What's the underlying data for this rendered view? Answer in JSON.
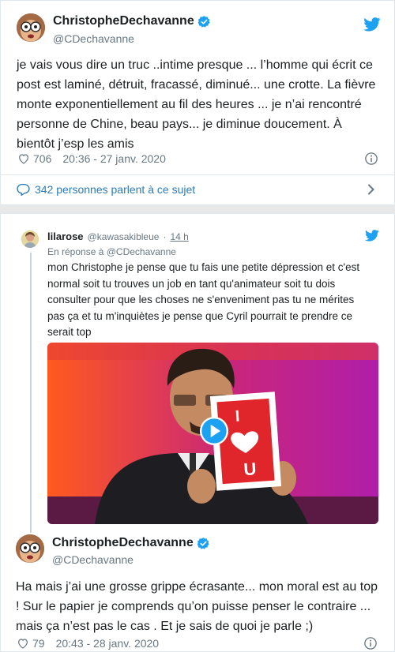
{
  "tweet1": {
    "display_name": "ChristopheDechavanne",
    "handle": "@CDechavanne",
    "text_lines": [
      "je vais vous dire un truc ..intime presque ... l’homme qui écrit ce",
      "post est laminé, détruit, fracassé, diminué... une crotte. La fièvre",
      "monte exponentiellement au fil des heures ... je n’ai rencontré",
      "personne de Chine, beau pays... je diminue doucement. À",
      "bientôt j’esp les amis"
    ],
    "likes": "706",
    "timestamp": "20:36 - 27 janv. 2020",
    "conversation_label": "342 personnes parlent à ce sujet"
  },
  "reply": {
    "display_name": "lilarose",
    "handle": "@kawasakibleue",
    "time": "14 h",
    "separator": "·",
    "in_reply_to": "En réponse à @CDechavanne",
    "text_lines": [
      "mon Christophe je pense que tu fais une petite dépression et c'est",
      "normal soit tu trouves un job en tant qu'animateur soit tu dois",
      "consulter pour que les choses ne s'enveniment pas tu ne mérites",
      "pas ça et tu m'inquiètes je pense que Cyril pourrait te prendre ce",
      "serait top"
    ],
    "sign_letters": [
      "I",
      "U"
    ]
  },
  "tweet2": {
    "display_name": "ChristopheDechavanne",
    "handle": "@CDechavanne",
    "text_lines": [
      "Ha mais j’ai une grosse grippe écrasante... mon moral est au top",
      "! Sur le papier je comprends qu’on puisse penser le contraire ...",
      "mais ça n’est pas le cas . Et je sais de quoi je parle ;)"
    ],
    "likes": "79",
    "timestamp": "20:43 - 28 janv. 2020"
  },
  "colors": {
    "twitter_blue": "#1da1f2",
    "link_blue": "#2b7bb9",
    "verified_blue": "#1da1f2",
    "muted": "#697882",
    "sign_red": "#e0262b"
  },
  "icons": {
    "bird": "twitter-bird-icon",
    "verified": "verified-badge-icon",
    "heart": "heart-icon",
    "info": "info-icon",
    "comment": "comment-icon",
    "chevron": "chevron-right-icon",
    "play": "play-icon"
  }
}
